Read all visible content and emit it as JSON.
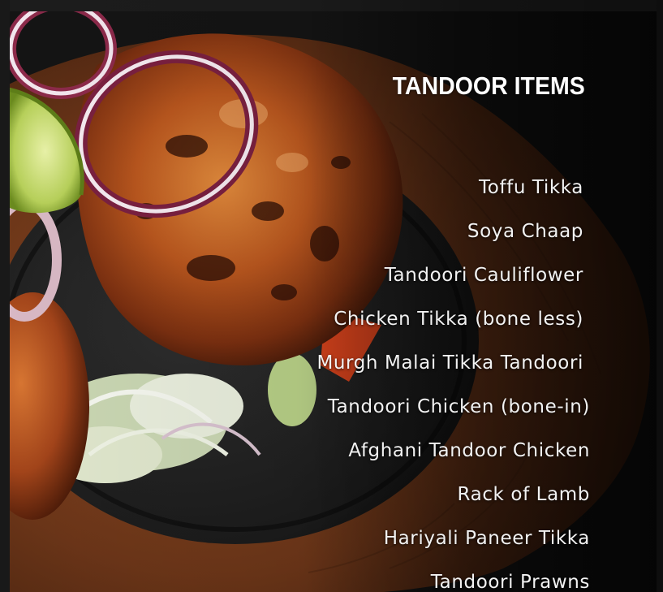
{
  "section": {
    "title": "TANDOOR ITEMS"
  },
  "menu": {
    "items": [
      {
        "label": "Toffu Tikka"
      },
      {
        "label": "Soya Chaap"
      },
      {
        "label": "Tandoori Cauliflower"
      },
      {
        "label": "Chicken Tikka (bone less)"
      },
      {
        "label": "Murgh Malai Tikka Tandoori"
      },
      {
        "label": "Tandoori Chicken (bone-in)"
      },
      {
        "label": "Afghani Tandoor Chicken"
      },
      {
        "label": "Rack of Lamb"
      },
      {
        "label": "Hariyali Paneer Tikka"
      },
      {
        "label": "Tandoori Prawns"
      }
    ]
  },
  "colors": {
    "background": "#151515",
    "text": "#ffffff",
    "wood": "#6b3a1f",
    "skillet": "#1c1c1c"
  }
}
